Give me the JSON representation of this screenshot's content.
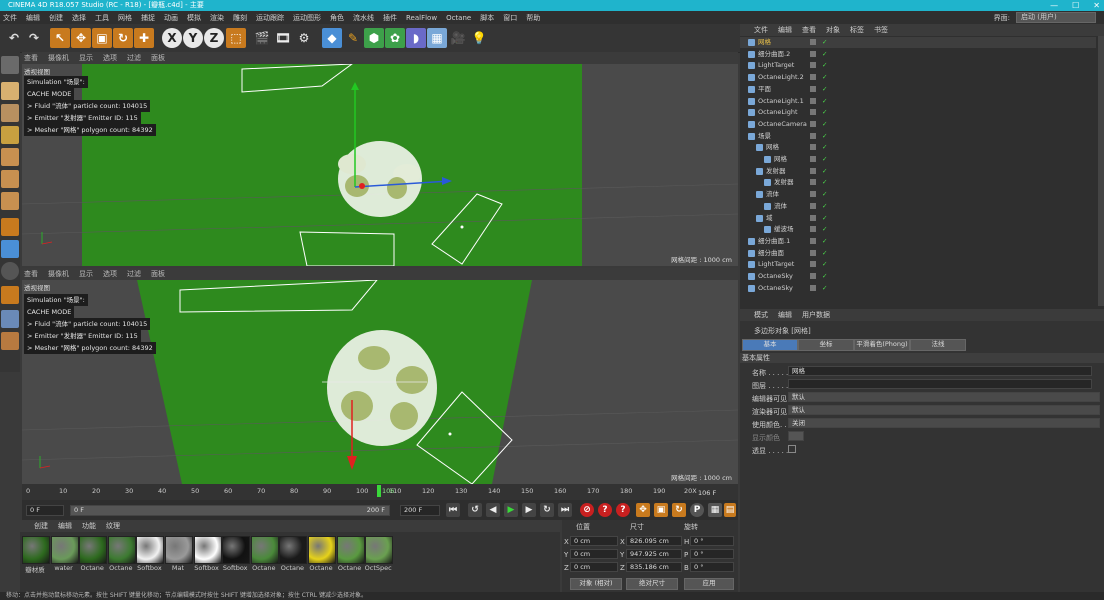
{
  "window": {
    "title": "CINEMA 4D R18.057 Studio (RC - R18) - [瓣瓶.c4d] - 主要"
  },
  "menu": [
    "文件",
    "编辑",
    "创建",
    "选择",
    "工具",
    "网格",
    "捕捉",
    "动画",
    "模拟",
    "渲染",
    "雕刻",
    "运动跟踪",
    "运动图形",
    "角色",
    "流水线",
    "插件",
    "RealFlow",
    "Octane",
    "脚本",
    "窗口",
    "帮助"
  ],
  "layout": {
    "label": "界面:",
    "value": "启动 (用户)"
  },
  "viewport_menu": [
    "查看",
    "摄像机",
    "显示",
    "选项",
    "过滤",
    "面板"
  ],
  "viewport_top": {
    "label": "透视视图",
    "info": [
      "Simulation \"场景\":",
      "CACHE MODE",
      "  > Fluid \"流体\" particle count: 104015",
      "  > Emitter \"发射器\" Emitter ID: 115",
      "  > Mesher \"网格\" polygon count: 84392"
    ],
    "grid": "网格间距 : 1000 cm"
  },
  "viewport_bottom": {
    "label": "透视视图",
    "info": [
      "Simulation \"场景\":",
      "CACHE MODE",
      "  > Fluid \"流体\" particle count: 104015",
      "  > Emitter \"发射器\" Emitter ID: 115",
      "  > Mesher \"网格\" polygon count: 84392"
    ],
    "grid": "网格间距 : 1000 cm"
  },
  "timeline": {
    "ticks": [
      "0",
      "10",
      "20",
      "30",
      "40",
      "50",
      "60",
      "70",
      "80",
      "90",
      "100",
      "110",
      "120",
      "130",
      "140",
      "150",
      "160",
      "170",
      "180",
      "190",
      "20X"
    ],
    "current": "106",
    "end_label": "106 F"
  },
  "playback": {
    "start": "0 F",
    "start2": "0 F",
    "end": "200 F",
    "end2": "200 F"
  },
  "materials": {
    "menu": [
      "创建",
      "编辑",
      "功能",
      "纹理"
    ],
    "items": [
      {
        "label": "瓣材质",
        "color": "#2d6a1e"
      },
      {
        "label": "water",
        "color": "#6a9a5a"
      },
      {
        "label": "Octane",
        "color": "#2d6a1e"
      },
      {
        "label": "Octane",
        "color": "#3c7a30"
      },
      {
        "label": "Softbox",
        "color": "#f2f2f2"
      },
      {
        "label": "Mat",
        "color": "#9a9a9a"
      },
      {
        "label": "Softbox",
        "color": "#ffffff"
      },
      {
        "label": "Softbox",
        "color": "#111111"
      },
      {
        "label": "Octane",
        "color": "#4a8a3a"
      },
      {
        "label": "Octane",
        "color": "#1a1a1a"
      },
      {
        "label": "Octane",
        "color": "#e6d21a"
      },
      {
        "label": "Octane",
        "color": "#5a9a40"
      },
      {
        "label": "OctSpec",
        "color": "#6aa050"
      }
    ]
  },
  "coords": {
    "headers": [
      "位置",
      "尺寸",
      "旋转"
    ],
    "rows": [
      {
        "axis": "X",
        "pos": "0 cm",
        "size": "826.095 cm",
        "rlabel": "H",
        "rot": "0 °"
      },
      {
        "axis": "Y",
        "pos": "0 cm",
        "size": "947.925 cm",
        "rlabel": "P",
        "rot": "0 °"
      },
      {
        "axis": "Z",
        "pos": "0 cm",
        "size": "835.186 cm",
        "rlabel": "B",
        "rot": "0 °"
      }
    ],
    "mode1": "对象 (相对)",
    "mode2": "绝对尺寸",
    "apply": "应用"
  },
  "objects": {
    "menu": [
      "文件",
      "编辑",
      "查看",
      "对象",
      "标签",
      "书签"
    ],
    "rows": [
      {
        "name": "网格",
        "indent": 0,
        "color": "#e8c04a"
      },
      {
        "name": "细分曲面.2",
        "indent": 0,
        "color": "#cfcfcf"
      },
      {
        "name": "LightTarget",
        "indent": 0,
        "color": "#cfcfcf"
      },
      {
        "name": "OctaneLight.2",
        "indent": 0,
        "color": "#cfcfcf"
      },
      {
        "name": "平面",
        "indent": 0,
        "color": "#cfcfcf"
      },
      {
        "name": "OctaneLight.1",
        "indent": 0,
        "color": "#cfcfcf"
      },
      {
        "name": "OctaneLight",
        "indent": 0,
        "color": "#cfcfcf"
      },
      {
        "name": "OctaneCamera",
        "indent": 0,
        "color": "#cfcfcf"
      },
      {
        "name": "场景",
        "indent": 0,
        "color": "#cfcfcf"
      },
      {
        "name": "网格",
        "indent": 1,
        "color": "#cfcfcf"
      },
      {
        "name": "网格",
        "indent": 2,
        "color": "#cfcfcf"
      },
      {
        "name": "发射器",
        "indent": 1,
        "color": "#cfcfcf"
      },
      {
        "name": "发射器",
        "indent": 2,
        "color": "#cfcfcf"
      },
      {
        "name": "流体",
        "indent": 1,
        "color": "#cfcfcf"
      },
      {
        "name": "流体",
        "indent": 2,
        "color": "#cfcfcf"
      },
      {
        "name": "域",
        "indent": 1,
        "color": "#cfcfcf"
      },
      {
        "name": "缓波场",
        "indent": 2,
        "color": "#cfcfcf"
      },
      {
        "name": "细分曲面.1",
        "indent": 0,
        "color": "#cfcfcf"
      },
      {
        "name": "细分曲面",
        "indent": 0,
        "color": "#cfcfcf"
      },
      {
        "name": "LightTarget",
        "indent": 0,
        "color": "#cfcfcf"
      },
      {
        "name": "OctaneSky",
        "indent": 0,
        "color": "#cfcfcf"
      },
      {
        "name": "OctaneSky",
        "indent": 0,
        "color": "#cfcfcf"
      }
    ]
  },
  "attributes": {
    "menu": [
      "模式",
      "编辑",
      "用户数据"
    ],
    "title": "多边形对象 [网格]",
    "tabs": [
      "基本",
      "坐标",
      "平滑着色(Phong)",
      "法线"
    ],
    "section": "基本属性",
    "fields": [
      {
        "label": "名称 . . . . .",
        "value": "网格"
      },
      {
        "label": "图层 . . . . .",
        "value": ""
      },
      {
        "label": "编辑器可见",
        "value": "默认"
      },
      {
        "label": "渲染器可见",
        "value": "默认"
      },
      {
        "label": "使用颜色. . . .",
        "value": "关闭"
      },
      {
        "label": "显示颜色",
        "value": ""
      },
      {
        "label": "透显 . . . . .",
        "value": ""
      }
    ]
  },
  "status": "移动：点击并拖动鼠标移动元素。按住 SHIFT 键量化移动；节点编辑模式时按住 SHIFT 键增加选择对象；按住 CTRL 键减少选择对象。"
}
